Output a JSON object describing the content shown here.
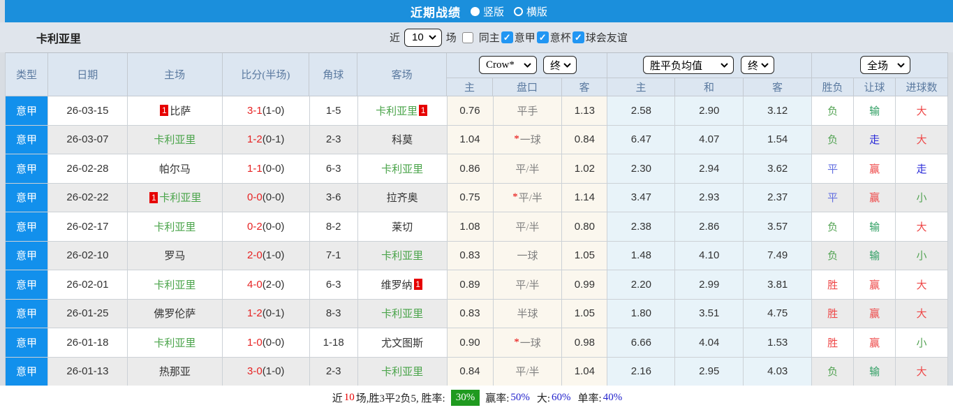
{
  "banner": {
    "title": "近期战绩",
    "layout_options": [
      {
        "label": "竖版",
        "selected": true
      },
      {
        "label": "横版",
        "selected": false
      }
    ]
  },
  "filter": {
    "team": "卡利亚里",
    "near_label": "近",
    "count_value": "10",
    "games_label": "场",
    "same_home": {
      "label": "同主",
      "checked": false
    },
    "competitions": [
      {
        "label": "意甲",
        "checked": true
      },
      {
        "label": "意杯",
        "checked": true
      },
      {
        "label": "球会友谊",
        "checked": true
      }
    ]
  },
  "table": {
    "main_headers": [
      "类型",
      "日期",
      "主场",
      "比分(半场)",
      "角球",
      "客场"
    ],
    "selects": {
      "odds_company": "Crow*",
      "odds_time": "终",
      "avg_type": "胜平负均值",
      "avg_time": "终",
      "result_scope": "全场"
    },
    "sub_headers": [
      "主",
      "盘口",
      "客",
      "主",
      "和",
      "客",
      "胜负",
      "让球",
      "进球数"
    ],
    "rows": [
      {
        "type": "意甲",
        "date": "26-03-15",
        "home": "比萨",
        "home_green": false,
        "home_badge": "1",
        "score": "3-1",
        "half": "(1-0)",
        "corners": "1-5",
        "away": "卡利亚里",
        "away_green": true,
        "away_badge": "1",
        "o_home": "0.76",
        "o_star": false,
        "o_line": "平手",
        "o_away": "1.13",
        "a_home": "2.58",
        "a_draw": "2.90",
        "a_away": "3.12",
        "r_spf": "负",
        "r_spf_c": "green",
        "r_let": "输",
        "r_let_c": "tgreen",
        "r_total": "大",
        "r_total_c": "red"
      },
      {
        "type": "意甲",
        "date": "26-03-07",
        "home": "卡利亚里",
        "home_green": true,
        "home_badge": null,
        "score": "1-2",
        "half": "(0-1)",
        "corners": "2-3",
        "away": "科莫",
        "away_green": false,
        "away_badge": null,
        "o_home": "1.04",
        "o_star": true,
        "o_line": "一球",
        "o_away": "0.84",
        "a_home": "6.47",
        "a_draw": "4.07",
        "a_away": "1.54",
        "r_spf": "负",
        "r_spf_c": "green",
        "r_let": "走",
        "r_let_c": "dblue",
        "r_total": "大",
        "r_total_c": "red"
      },
      {
        "type": "意甲",
        "date": "26-02-28",
        "home": "帕尔马",
        "home_green": false,
        "home_badge": null,
        "score": "1-1",
        "half": "(0-0)",
        "corners": "6-3",
        "away": "卡利亚里",
        "away_green": true,
        "away_badge": null,
        "o_home": "0.86",
        "o_star": false,
        "o_line": "平/半",
        "o_away": "1.02",
        "a_home": "2.30",
        "a_draw": "2.94",
        "a_away": "3.62",
        "r_spf": "平",
        "r_spf_c": "blue",
        "r_let": "赢",
        "r_let_c": "red",
        "r_total": "走",
        "r_total_c": "dblue"
      },
      {
        "type": "意甲",
        "date": "26-02-22",
        "home": "卡利亚里",
        "home_green": true,
        "home_badge": "1",
        "score": "0-0",
        "half": "(0-0)",
        "corners": "3-6",
        "away": "拉齐奥",
        "away_green": false,
        "away_badge": null,
        "o_home": "0.75",
        "o_star": true,
        "o_line": "平/半",
        "o_away": "1.14",
        "a_home": "3.47",
        "a_draw": "2.93",
        "a_away": "2.37",
        "r_spf": "平",
        "r_spf_c": "blue",
        "r_let": "赢",
        "r_let_c": "red",
        "r_total": "小",
        "r_total_c": "green"
      },
      {
        "type": "意甲",
        "date": "26-02-17",
        "home": "卡利亚里",
        "home_green": true,
        "home_badge": null,
        "score": "0-2",
        "half": "(0-0)",
        "corners": "8-2",
        "away": "莱切",
        "away_green": false,
        "away_badge": null,
        "o_home": "1.08",
        "o_star": false,
        "o_line": "平/半",
        "o_away": "0.80",
        "a_home": "2.38",
        "a_draw": "2.86",
        "a_away": "3.57",
        "r_spf": "负",
        "r_spf_c": "green",
        "r_let": "输",
        "r_let_c": "tgreen",
        "r_total": "大",
        "r_total_c": "red"
      },
      {
        "type": "意甲",
        "date": "26-02-10",
        "home": "罗马",
        "home_green": false,
        "home_badge": null,
        "score": "2-0",
        "half": "(1-0)",
        "corners": "7-1",
        "away": "卡利亚里",
        "away_green": true,
        "away_badge": null,
        "o_home": "0.83",
        "o_star": false,
        "o_line": "一球",
        "o_away": "1.05",
        "a_home": "1.48",
        "a_draw": "4.10",
        "a_away": "7.49",
        "r_spf": "负",
        "r_spf_c": "green",
        "r_let": "输",
        "r_let_c": "tgreen",
        "r_total": "小",
        "r_total_c": "green"
      },
      {
        "type": "意甲",
        "date": "26-02-01",
        "home": "卡利亚里",
        "home_green": true,
        "home_badge": null,
        "score": "4-0",
        "half": "(2-0)",
        "corners": "6-3",
        "away": "维罗纳",
        "away_green": false,
        "away_badge": "1",
        "o_home": "0.89",
        "o_star": false,
        "o_line": "平/半",
        "o_away": "0.99",
        "a_home": "2.20",
        "a_draw": "2.99",
        "a_away": "3.81",
        "r_spf": "胜",
        "r_spf_c": "red",
        "r_let": "赢",
        "r_let_c": "red",
        "r_total": "大",
        "r_total_c": "red"
      },
      {
        "type": "意甲",
        "date": "26-01-25",
        "home": "佛罗伦萨",
        "home_green": false,
        "home_badge": null,
        "score": "1-2",
        "half": "(0-1)",
        "corners": "8-3",
        "away": "卡利亚里",
        "away_green": true,
        "away_badge": null,
        "o_home": "0.83",
        "o_star": false,
        "o_line": "半球",
        "o_away": "1.05",
        "a_home": "1.80",
        "a_draw": "3.51",
        "a_away": "4.75",
        "r_spf": "胜",
        "r_spf_c": "red",
        "r_let": "赢",
        "r_let_c": "red",
        "r_total": "大",
        "r_total_c": "red"
      },
      {
        "type": "意甲",
        "date": "26-01-18",
        "home": "卡利亚里",
        "home_green": true,
        "home_badge": null,
        "score": "1-0",
        "half": "(0-0)",
        "corners": "1-18",
        "away": "尤文图斯",
        "away_green": false,
        "away_badge": null,
        "o_home": "0.90",
        "o_star": true,
        "o_line": "一球",
        "o_away": "0.98",
        "a_home": "6.66",
        "a_draw": "4.04",
        "a_away": "1.53",
        "r_spf": "胜",
        "r_spf_c": "red",
        "r_let": "赢",
        "r_let_c": "red",
        "r_total": "小",
        "r_total_c": "green"
      },
      {
        "type": "意甲",
        "date": "26-01-13",
        "home": "热那亚",
        "home_green": false,
        "home_badge": null,
        "score": "3-0",
        "half": "(1-0)",
        "corners": "2-3",
        "away": "卡利亚里",
        "away_green": true,
        "away_badge": null,
        "o_home": "0.84",
        "o_star": false,
        "o_line": "平/半",
        "o_away": "1.04",
        "a_home": "2.16",
        "a_draw": "2.95",
        "a_away": "4.03",
        "r_spf": "负",
        "r_spf_c": "green",
        "r_let": "输",
        "r_let_c": "tgreen",
        "r_total": "大",
        "r_total_c": "red"
      }
    ]
  },
  "footer": {
    "near_label": "近",
    "count": "10",
    "summary": "场,胜3平2负5, 胜率:",
    "win_rate": "30%",
    "stats": [
      {
        "label": "赢率:",
        "value": "50%"
      },
      {
        "label": "大:",
        "value": "60%"
      },
      {
        "label": "单率:",
        "value": "40%"
      }
    ]
  },
  "colors": {
    "banner_blue": "#1b8fdc",
    "type_cell_blue": "#1290ec",
    "checkbox_blue": "#2196f3",
    "team_green": "#4aa44a",
    "score_red": "#e62222",
    "result_red": "#ee4747",
    "result_green": "#55a455",
    "result_teal_green": "#2e9e62",
    "result_blue": "#6470e0",
    "result_dark_blue": "#2a2ad8",
    "win_badge_green": "#1f9a1f",
    "stat_blue": "#2222cc",
    "odds_cream_bg": "#fbf7ee",
    "avg_blue_bg": "#e8f3f9",
    "header_bg": "#dce6f1",
    "stripe_gray": "#ebebeb"
  }
}
